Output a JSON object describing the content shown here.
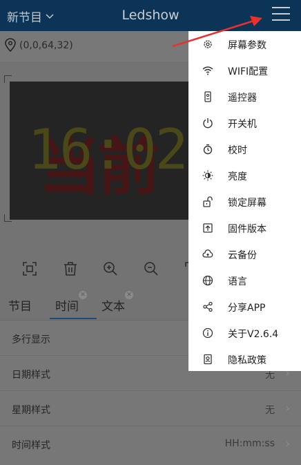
{
  "header": {
    "program_label": "新节目",
    "app_title": "Ledshow"
  },
  "coords": "(0,0,64,32)",
  "led": {
    "time": "16:02",
    "ghost_text": "当前"
  },
  "tabs": [
    {
      "label": "节目"
    },
    {
      "label": "时间"
    },
    {
      "label": "文本"
    }
  ],
  "settings": [
    {
      "label": "多行显示",
      "value": ""
    },
    {
      "label": "日期样式",
      "value": "无"
    },
    {
      "label": "星期样式",
      "value": "无"
    },
    {
      "label": "时间样式",
      "value": "HH:mm:ss"
    }
  ],
  "menu": [
    {
      "label": "屏幕参数",
      "icon": "gear-icon"
    },
    {
      "label": "WIFI配置",
      "icon": "wifi-icon"
    },
    {
      "label": "遥控器",
      "icon": "remote-icon"
    },
    {
      "label": "开关机",
      "icon": "power-icon"
    },
    {
      "label": "校时",
      "icon": "timer-icon"
    },
    {
      "label": "亮度",
      "icon": "brightness-icon"
    },
    {
      "label": "锁定屏幕",
      "icon": "lock-icon"
    },
    {
      "label": "固件版本",
      "icon": "firmware-icon"
    },
    {
      "label": "云备份",
      "icon": "cloud-icon"
    },
    {
      "label": "语言",
      "icon": "globe-icon"
    },
    {
      "label": "分享APP",
      "icon": "share-icon"
    },
    {
      "label": "关于V2.6.4",
      "icon": "info-icon"
    },
    {
      "label": "隐私政策",
      "icon": "privacy-icon"
    }
  ],
  "colors": {
    "header_bg": "#0c3457",
    "annotation_arrow": "#e8312e",
    "tab_underline": "#1a4a77"
  }
}
